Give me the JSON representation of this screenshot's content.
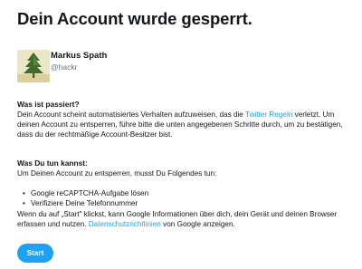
{
  "page": {
    "title": "Dein Account wurde gesperrt."
  },
  "user": {
    "name": "Markus Spath",
    "handle": "@hackr",
    "avatar_icon": "tree-avatar"
  },
  "what_happened": {
    "heading": "Was ist passiert?",
    "text_before_link": "Dein Account scheint automatisiertes Verhalten aufzuweisen, das die ",
    "link_label": "Twitter Regeln",
    "text_after_link": " verletzt. Um deinen Account zu entsperren, führe bitte die unten angegebenen Schritte durch, um zu bestätigen, dass du der rechtmäßige Account-Besitzer bist."
  },
  "what_to_do": {
    "heading": "Was Du tun kannst:",
    "intro": "Um Deinen Account zu entsperren, musst Du Folgendes tun:",
    "steps": [
      "Google reCAPTCHA-Aufgabe lösen",
      "Verifiziere Deine Telefonnummer"
    ],
    "notice_before_link": "Wenn du auf „Start\" klickst, kann Google Informationen über dich, dein Gerät und deinen Browser erfassen und nutzen. ",
    "notice_link_label": "Datenschutzrichtlinien",
    "notice_after_link": " von Google anzeigen."
  },
  "actions": {
    "start_label": "Start"
  },
  "colors": {
    "accent": "#1da1f2",
    "text": "#14171a",
    "muted": "#657786"
  }
}
